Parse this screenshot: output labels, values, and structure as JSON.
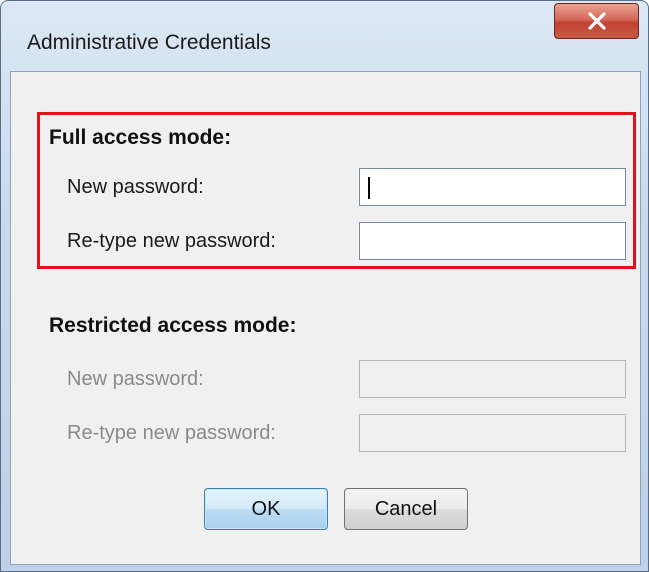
{
  "window": {
    "title": "Administrative Credentials",
    "close_label": "×"
  },
  "full_access": {
    "heading": "Full access mode:",
    "new_password_label": "New password:",
    "retype_password_label": "Re-type new password:",
    "new_password_value": "",
    "retype_password_value": "",
    "highlight_color": "#e2121a"
  },
  "restricted_access": {
    "heading": "Restricted access mode:",
    "new_password_label": "New password:",
    "retype_password_label": "Re-type new password:",
    "new_password_value": "",
    "retype_password_value": ""
  },
  "buttons": {
    "ok_label": "OK",
    "cancel_label": "Cancel"
  },
  "icons": {
    "close": "close-icon"
  }
}
